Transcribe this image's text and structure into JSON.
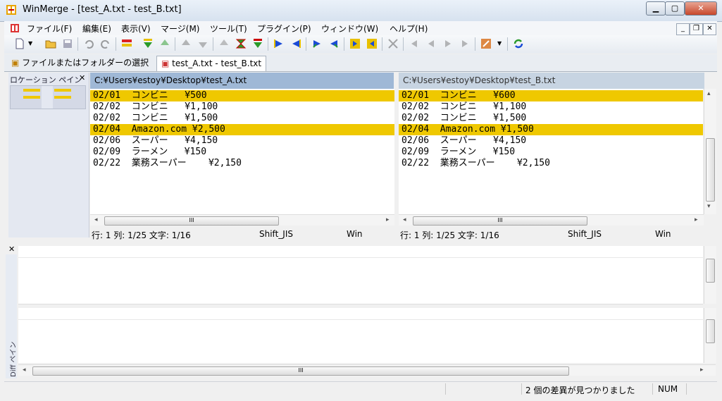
{
  "window": {
    "title": "WinMerge - [test_A.txt - test_B.txt]"
  },
  "menu": [
    "ファイル(F)",
    "編集(E)",
    "表示(V)",
    "マージ(M)",
    "ツール(T)",
    "プラグイン(P)",
    "ウィンドウ(W)",
    "ヘルプ(H)"
  ],
  "tabs": {
    "select": "ファイルまたはフォルダーの選択",
    "compare": "test_A.txt - test_B.txt"
  },
  "location_pane": {
    "title": "ロケーション ペイン"
  },
  "left": {
    "path": "C:¥Users¥estoy¥Desktop¥test_A.txt",
    "lines": [
      {
        "text": "02/01  コンビニ   ¥500",
        "diff": true
      },
      {
        "text": "02/02  コンビニ   ¥1,100",
        "diff": false
      },
      {
        "text": "02/02  コンビニ   ¥1,500",
        "diff": false
      },
      {
        "text": "02/04  Amazon.com ¥2,500",
        "diff": true
      },
      {
        "text": "02/06  スーパー   ¥4,150",
        "diff": false
      },
      {
        "text": "02/09  ラーメン   ¥150",
        "diff": false
      },
      {
        "text": "02/22  業務スーパー    ¥2,150",
        "diff": false
      }
    ],
    "status": {
      "pos": "行: 1  列: 1/25  文字: 1/16",
      "encoding": "Shift_JIS",
      "eol": "Win"
    }
  },
  "right": {
    "path": "C:¥Users¥estoy¥Desktop¥test_B.txt",
    "lines": [
      {
        "text": "02/01  コンビニ   ¥600",
        "diff": true
      },
      {
        "text": "02/02  コンビニ   ¥1,100",
        "diff": false
      },
      {
        "text": "02/02  コンビニ   ¥1,500",
        "diff": false
      },
      {
        "text": "02/04  Amazon.com ¥1,500",
        "diff": true
      },
      {
        "text": "02/06  スーパー   ¥4,150",
        "diff": false
      },
      {
        "text": "02/09  ラーメン   ¥150",
        "diff": false
      },
      {
        "text": "02/22  業務スーパー    ¥2,150",
        "diff": false
      }
    ],
    "status": {
      "pos": "行: 1  列: 1/25  文字: 1/16",
      "encoding": "Shift_JIS",
      "eol": "Win"
    }
  },
  "diff_pane": {
    "label": "Diff ペイン"
  },
  "statusbar": {
    "message": "2 個の差異が見つかりました",
    "num": "NUM"
  },
  "colors": {
    "diff_highlight": "#efc800",
    "left_header": "#9fb8d6",
    "right_header": "#c7d4e2"
  }
}
